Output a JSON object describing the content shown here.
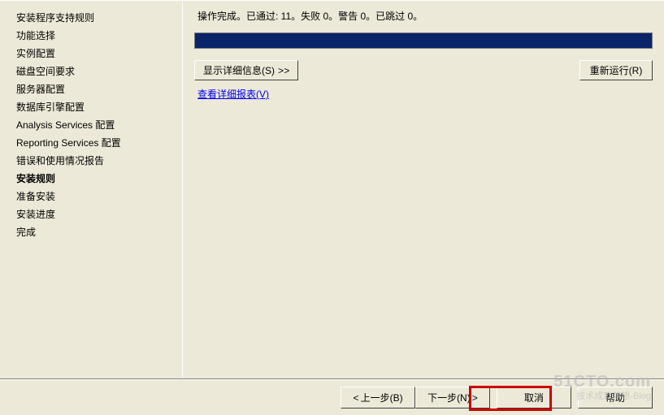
{
  "sidebar": {
    "items": [
      {
        "label": "安装程序支持规则",
        "current": false
      },
      {
        "label": "功能选择",
        "current": false
      },
      {
        "label": "实例配置",
        "current": false
      },
      {
        "label": "磁盘空间要求",
        "current": false
      },
      {
        "label": "服务器配置",
        "current": false
      },
      {
        "label": "数据库引擎配置",
        "current": false
      },
      {
        "label": "Analysis Services 配置",
        "current": false
      },
      {
        "label": "Reporting Services 配置",
        "current": false
      },
      {
        "label": "错误和使用情况报告",
        "current": false
      },
      {
        "label": "安装规则",
        "current": true
      },
      {
        "label": "准备安装",
        "current": false
      },
      {
        "label": "安装进度",
        "current": false
      },
      {
        "label": "完成",
        "current": false
      }
    ]
  },
  "content": {
    "status": "操作完成。已通过: 11。失败 0。警告 0。已跳过 0。",
    "show_details_label": "显示详细信息(S)",
    "rerun_label": "重新运行(R)",
    "view_report_link": "查看详细报表(V)"
  },
  "footer": {
    "back_label": "上一步(B)",
    "next_label": "下一步(N)",
    "cancel_label": "取消",
    "help_label": "帮助"
  },
  "watermark": {
    "line1": "51CTO.com",
    "line2": "技术成就梦想-Blog"
  }
}
